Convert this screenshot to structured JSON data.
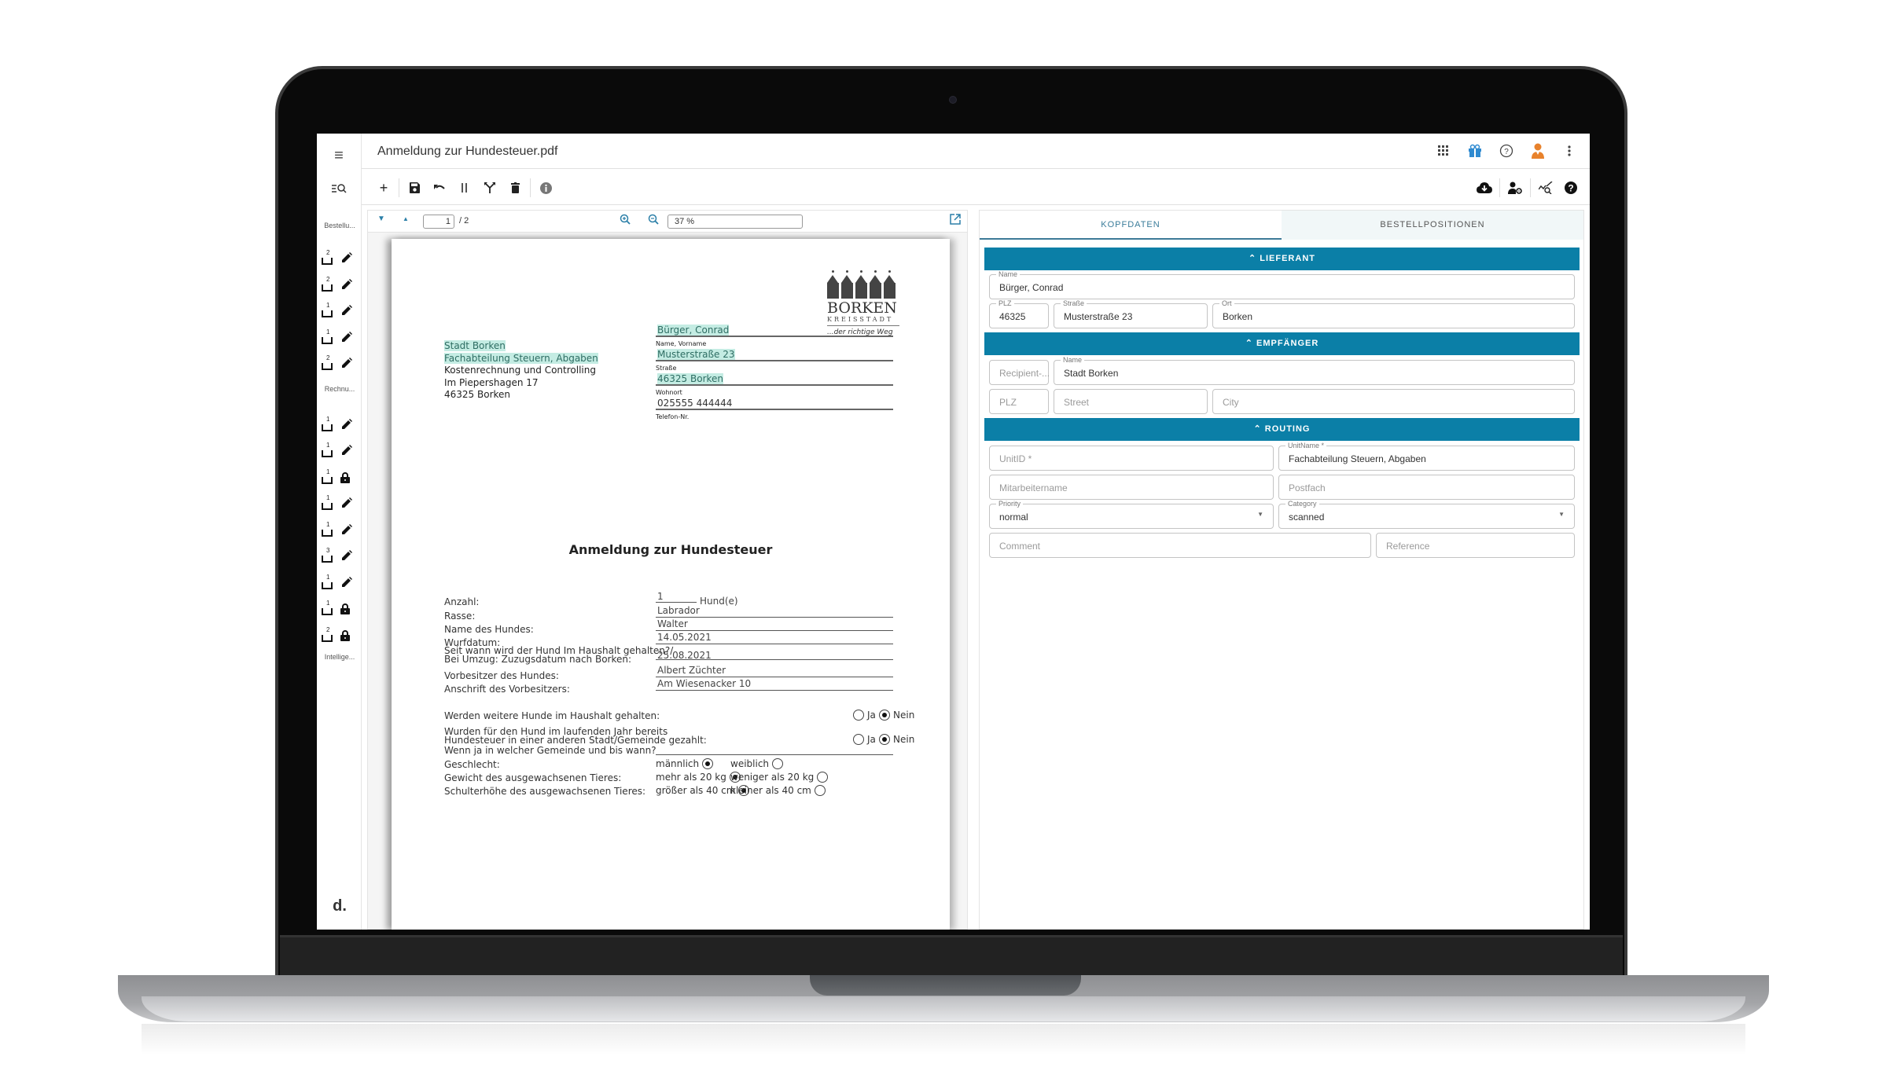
{
  "app": {
    "file_title": "Anmeldung zur Hundesteuer.pdf",
    "brand_mark": "d."
  },
  "header_icons": [
    "apps-grid-icon",
    "gift-icon",
    "help-circle-icon",
    "user-avatar-icon",
    "more-vert-icon"
  ],
  "toolbar": {
    "left": [
      "add-icon",
      "save-icon",
      "undo-icon",
      "pause-icon",
      "split-icon",
      "delete-icon",
      "info-icon"
    ],
    "right": [
      "cloud-download-icon",
      "user-settings-icon",
      "analytics-search-icon",
      "help-icon"
    ]
  },
  "rail": {
    "groups": [
      {
        "label": "Bestellu...",
        "items": [
          {
            "count": "2",
            "state": "edit"
          },
          {
            "count": "2",
            "state": "edit"
          },
          {
            "count": "1",
            "state": "edit"
          },
          {
            "count": "1",
            "state": "edit"
          },
          {
            "count": "2",
            "state": "edit"
          }
        ]
      },
      {
        "label": "Rechnu...",
        "items": [
          {
            "count": "1",
            "state": "edit"
          },
          {
            "count": "1",
            "state": "edit"
          },
          {
            "count": "1",
            "state": "locked"
          },
          {
            "count": "1",
            "state": "edit"
          },
          {
            "count": "1",
            "state": "edit"
          },
          {
            "count": "3",
            "state": "edit"
          },
          {
            "count": "1",
            "state": "edit"
          },
          {
            "count": "1",
            "state": "locked"
          },
          {
            "count": "2",
            "state": "locked"
          }
        ]
      },
      {
        "label": "Intellige...",
        "items": []
      }
    ]
  },
  "pdf_viewer": {
    "current_page": "1",
    "total_pages": "/ 2",
    "zoom": "37 %"
  },
  "document": {
    "logo": {
      "city": "BORKEN",
      "subtitle": "KREISSTADT",
      "claim": "...der richtige Weg"
    },
    "recipient_address": [
      "Stadt Borken",
      "Fachabteilung Steuern, Abgaben",
      "Kostenrechnung und Controlling",
      "Im Piepershagen 17",
      "46325 Borken"
    ],
    "sender_fields": [
      {
        "value": "Bürger, Conrad",
        "label": "Name, Vorname",
        "highlighted": true
      },
      {
        "value": "Musterstraße 23",
        "label": "Straße",
        "highlighted": true
      },
      {
        "value": "46325 Borken",
        "label": "Wohnort",
        "highlighted": true
      },
      {
        "value": "025555 444444",
        "label": "Telefon-Nr.",
        "highlighted": false
      }
    ],
    "title": "Anmeldung zur Hundesteuer",
    "count": {
      "label": "Anzahl:",
      "value": "1",
      "unit": "Hund(e)"
    },
    "rows": [
      {
        "label": "Rasse:",
        "value": "Labrador"
      },
      {
        "label": "Name des Hundes:",
        "value": "Walter"
      },
      {
        "label": "Wurfdatum:",
        "value": "14.05.2021"
      },
      {
        "label": "Seit wann wird der Hund Im Haushalt gehalten?/",
        "label2": "Bei Umzug: Zuzugsdatum nach Borken:",
        "value": "25.08.2021"
      },
      {
        "label": "Vorbesitzer des Hundes:",
        "value": "Albert Züchter"
      },
      {
        "label": "Anschrift des Vorbesitzers:",
        "value": "Am Wiesenacker 10"
      }
    ],
    "questions": [
      {
        "label": "Werden weitere Hunde im Haushalt gehalten:",
        "options": [
          {
            "label": "Ja",
            "checked": false
          },
          {
            "label": "Nein",
            "checked": true
          }
        ]
      },
      {
        "label": "Wurden für den Hund im laufenden Jahr bereits",
        "label2": "Hundesteuer in einer anderen Stadt/Gemeinde gezahlt:",
        "options": [
          {
            "label": "Ja",
            "checked": false
          },
          {
            "label": "Nein",
            "checked": true
          }
        ]
      },
      {
        "label": "Wenn ja in welcher Gemeinde und bis wann?",
        "value": ""
      },
      {
        "label": "Geschlecht:",
        "options": [
          {
            "label": "männlich",
            "checked": true
          },
          {
            "label": "weiblich",
            "checked": false
          }
        ]
      },
      {
        "label": "Gewicht des ausgewachsenen Tieres:",
        "options": [
          {
            "label": "mehr als 20 kg",
            "checked": true
          },
          {
            "label": "weniger als 20 kg",
            "checked": false
          }
        ]
      },
      {
        "label": "Schulterhöhe des ausgewachsenen Tieres:",
        "options": [
          {
            "label": "größer als 40 cm",
            "checked": true
          },
          {
            "label": "kleiner als 40 cm",
            "checked": false
          }
        ]
      }
    ]
  },
  "form": {
    "tabs": [
      {
        "label": "KOPFDATEN",
        "active": true
      },
      {
        "label": "BESTELLPOSITIONEN",
        "active": false
      }
    ],
    "sections": {
      "lieferant": "LIEFERANT",
      "empfaenger": "EMPFÄNGER",
      "routing": "ROUTING"
    },
    "lieferant": {
      "name": {
        "label": "Name",
        "value": "Bürger, Conrad"
      },
      "plz": {
        "label": "PLZ",
        "value": "46325"
      },
      "strasse": {
        "label": "Straße",
        "value": "Musterstraße 23"
      },
      "ort": {
        "label": "Ort",
        "value": "Borken"
      }
    },
    "empfaenger": {
      "recipient_id": {
        "placeholder": "Recipient-..."
      },
      "name": {
        "label": "Name",
        "value": "Stadt Borken"
      },
      "plz": {
        "placeholder": "PLZ"
      },
      "street": {
        "placeholder": "Street"
      },
      "city": {
        "placeholder": "City"
      }
    },
    "routing": {
      "unit_id": {
        "placeholder": "UnitID *"
      },
      "unit_name": {
        "label": "UnitName *",
        "value": "Fachabteilung Steuern, Abgaben"
      },
      "mitarbeiter": {
        "placeholder": "Mitarbeitername"
      },
      "postfach": {
        "placeholder": "Postfach"
      },
      "priority": {
        "label": "Priority",
        "value": "normal"
      },
      "category": {
        "label": "Category",
        "value": "scanned"
      },
      "comment": {
        "placeholder": "Comment"
      },
      "reference": {
        "placeholder": "Reference"
      }
    }
  },
  "colors": {
    "accent": "#0b7fa7",
    "highlight": "#c4ece3",
    "gift": "#2f8ad0",
    "avatar": "#e8822c"
  }
}
